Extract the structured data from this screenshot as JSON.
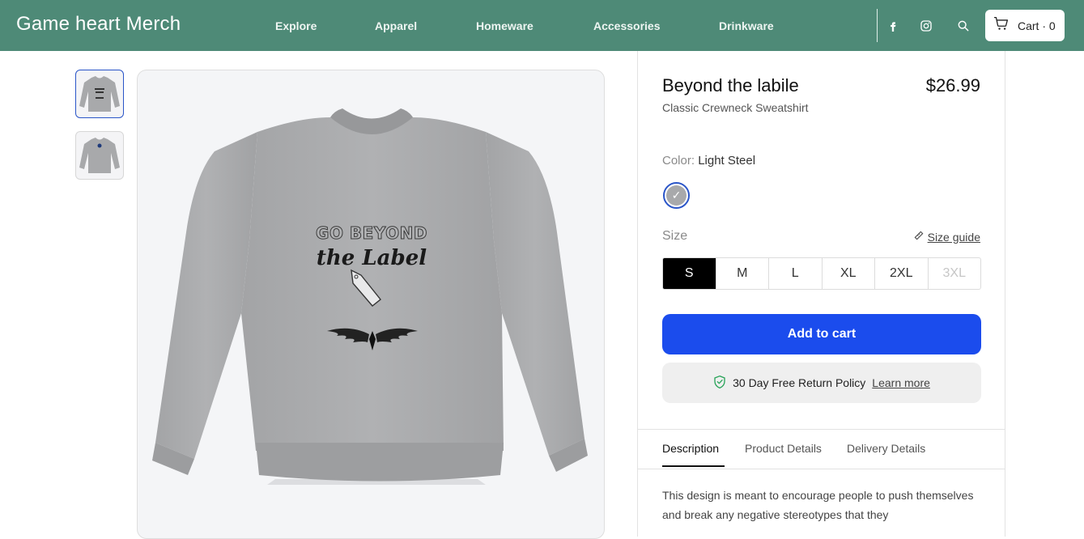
{
  "header": {
    "brand": "Game heart Merch",
    "nav": [
      "Explore",
      "Apparel",
      "Homeware",
      "Accessories",
      "Drinkware"
    ],
    "icons": [
      "facebook-icon",
      "instagram-icon",
      "search-icon"
    ],
    "cart_label": "Cart · 0",
    "bg_color": "#4e8a77"
  },
  "gallery": {
    "thumbnail_count": 2,
    "active_thumbnail": 1
  },
  "artwork": {
    "line1": "GO BEYOND",
    "line2": "the Label"
  },
  "product": {
    "title": "Beyond the labile",
    "price": "$26.99",
    "subtitle": "Classic Crewneck Sweatshirt",
    "color_label": "Color:",
    "color_value": "Light Steel",
    "size_label": "Size",
    "size_guide": "Size guide",
    "sizes": [
      "S",
      "M",
      "L",
      "XL",
      "2XL",
      "3XL"
    ],
    "selected_size": "S",
    "unavailable_sizes": [
      "3XL"
    ],
    "add_to_cart": "Add to cart",
    "return_policy": "30 Day Free Return Policy",
    "learn_more": "Learn more",
    "accent_color": "#1b4ced"
  },
  "tabs": [
    "Description",
    "Product Details",
    "Delivery Details"
  ],
  "description": "This design is meant to encourage people to push themselves and break any negative stereotypes that they"
}
